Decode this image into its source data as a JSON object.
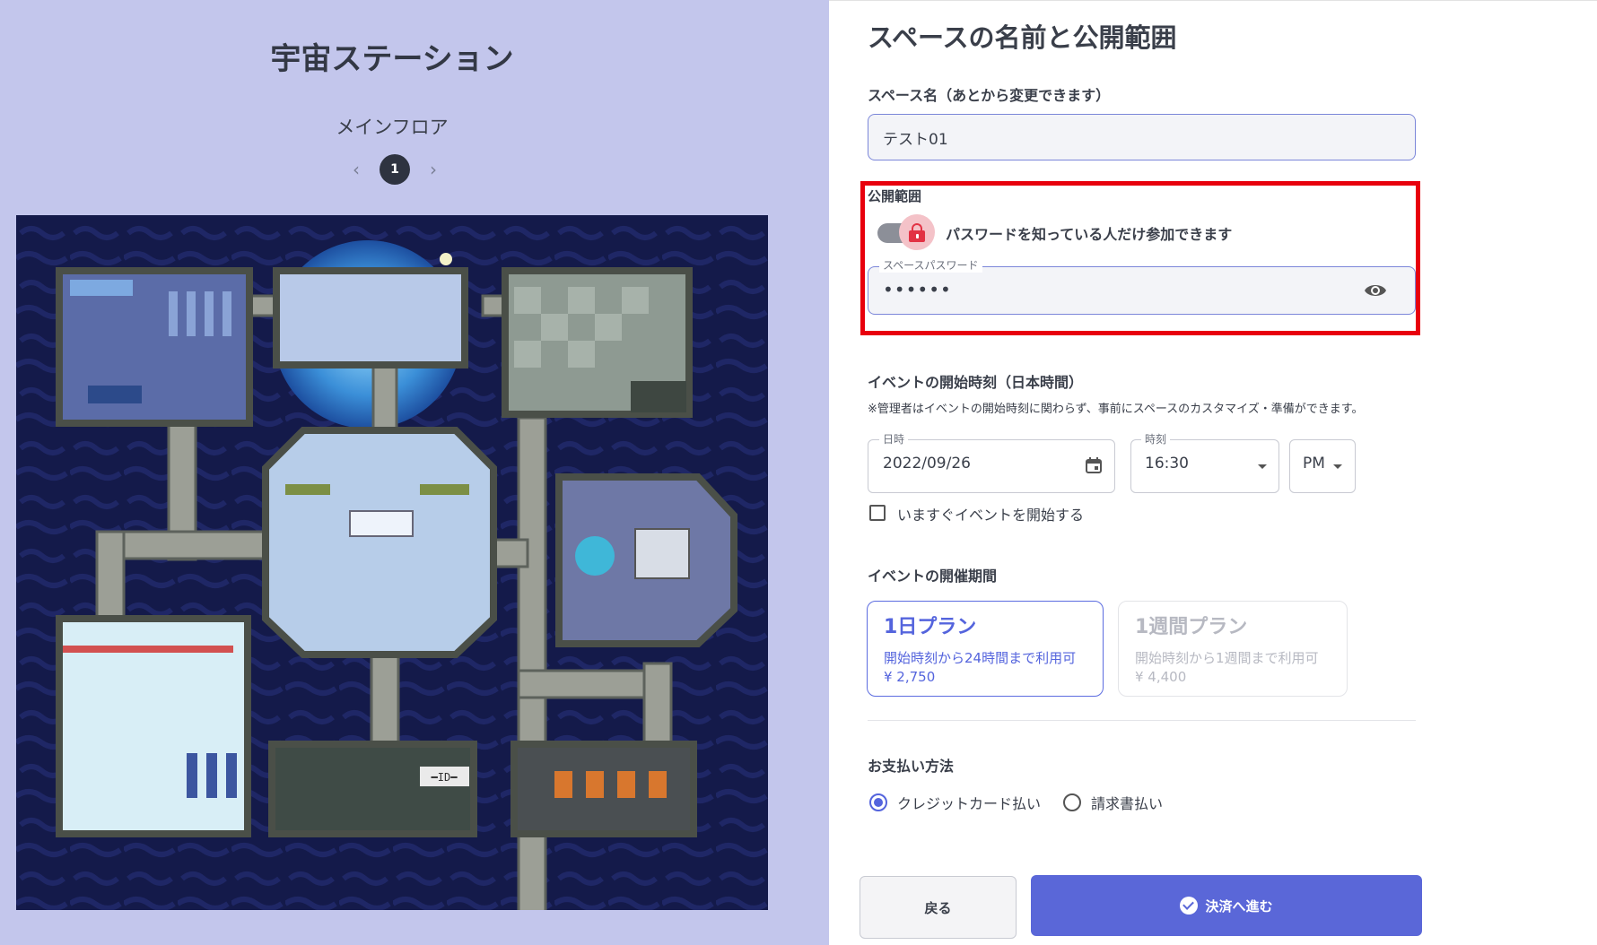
{
  "map_panel": {
    "title": "宇宙ステーション",
    "floor_name": "メインフロア",
    "pager": {
      "prev": "‹",
      "current": "1",
      "next": "›"
    },
    "room_label": "━ID━"
  },
  "form": {
    "title": "スペースの名前と公開範囲",
    "space_name": {
      "label": "スペース名（あとから変更できます）",
      "value": "テスト01"
    },
    "visibility": {
      "label": "公開範囲",
      "toggle_text": "パスワードを知っている人だけ参加できます",
      "password_legend": "スペースパスワード",
      "password_value": "••••••"
    },
    "start_time": {
      "label": "イベントの開始時刻（日本時間）",
      "note": "※管理者はイベントの開始時刻に関わらず、事前にスペースのカスタマイズ・準備ができます。",
      "date_legend": "日時",
      "date_value": "2022/09/26",
      "time_legend": "時刻",
      "time_value": "16:30",
      "ampm_value": "PM",
      "start_now_label": "いますぐイベントを開始する"
    },
    "duration": {
      "label": "イベントの開催期間",
      "plans": [
        {
          "name": "1日プラン",
          "desc": "開始時刻から24時間まで利用可",
          "price": "¥ 2,750"
        },
        {
          "name": "1週間プラン",
          "desc": "開始時刻から1週間まで利用可",
          "price": "¥ 4,400"
        }
      ]
    },
    "payment": {
      "label": "お支払い方法",
      "options": [
        "クレジットカード払い",
        "請求書払い"
      ]
    },
    "buttons": {
      "back": "戻る",
      "next": "決済へ進む"
    }
  },
  "colors": {
    "accent": "#5a67d8",
    "highlight": "#e8000d",
    "left_bg": "#c3c6ec",
    "map_bg": "#141a4a"
  }
}
